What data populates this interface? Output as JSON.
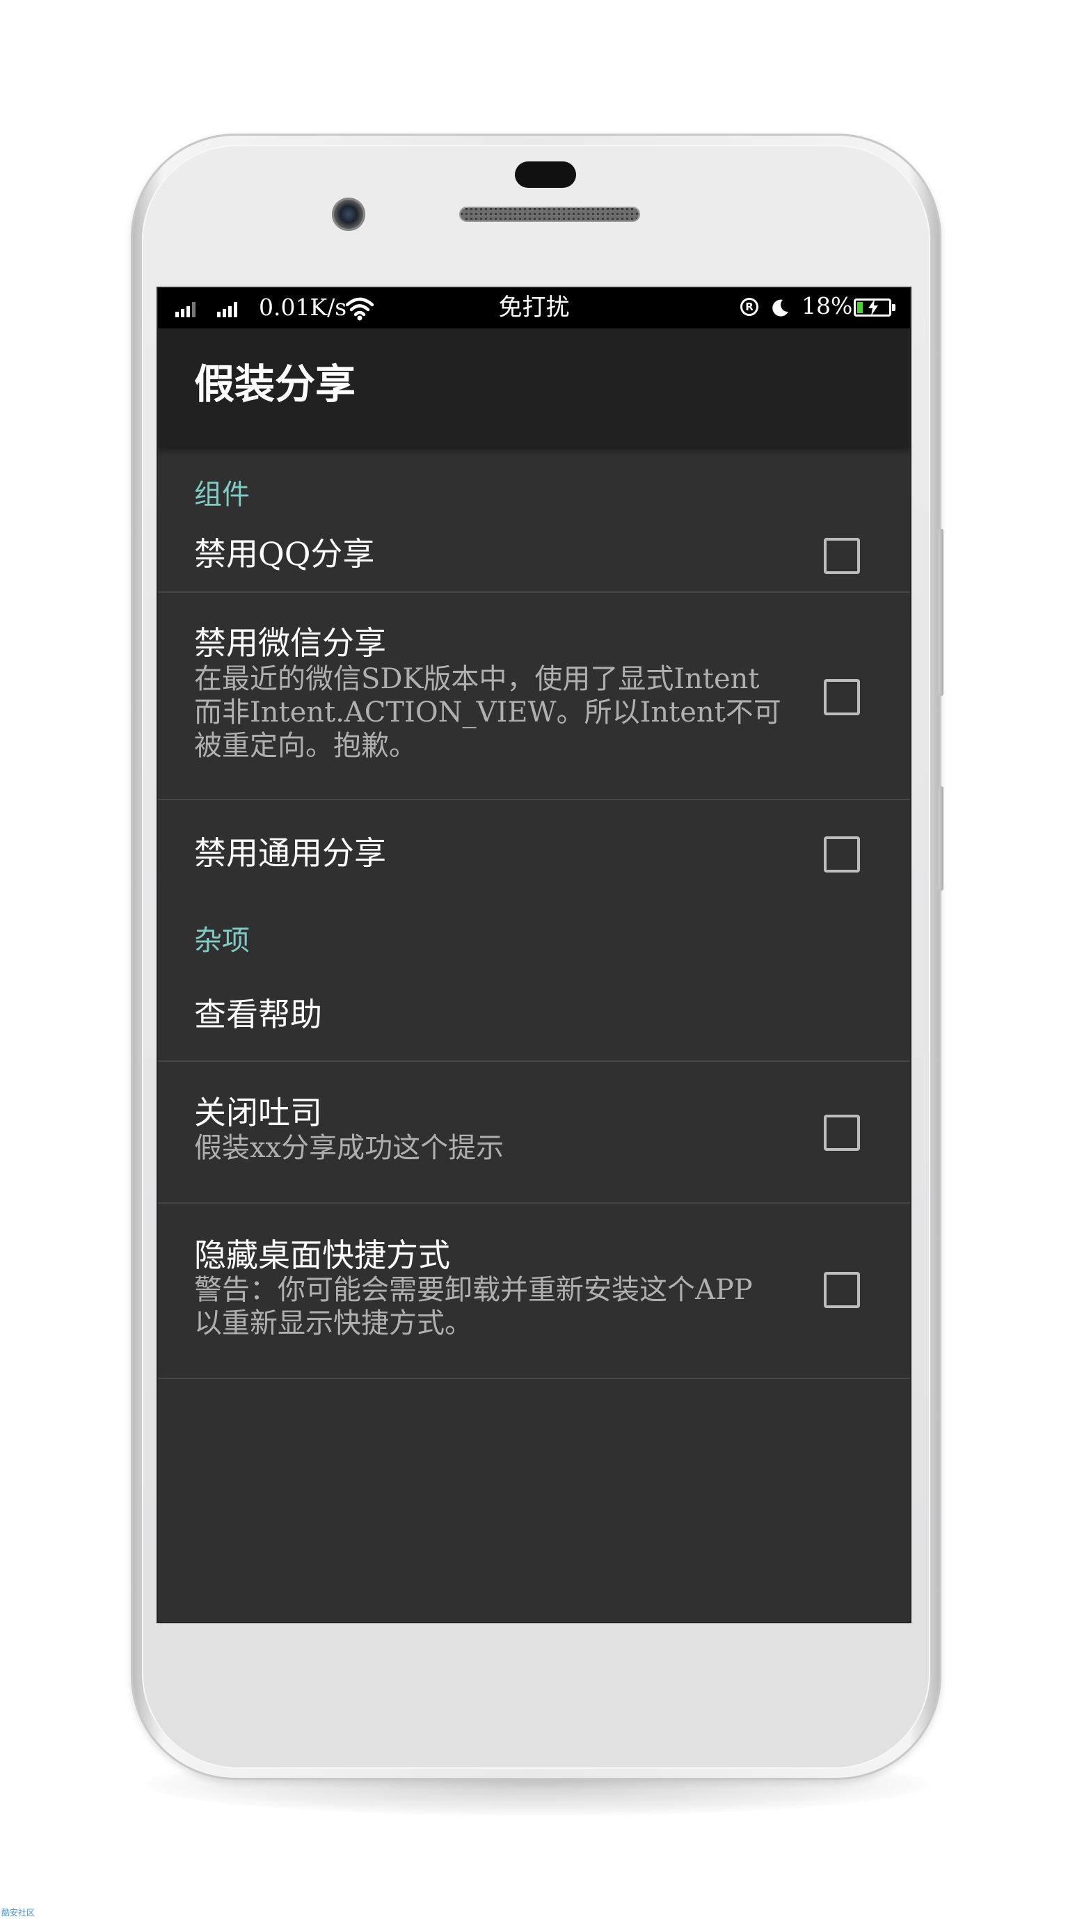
{
  "statusbar": {
    "net_speed": "0.01K/s",
    "mode": "免打扰",
    "r_badge": "R",
    "battery_pct": "18%",
    "battery_level": 0.18,
    "icons": [
      "signal-icon",
      "signal-icon",
      "wifi-icon",
      "registered-icon",
      "moon-icon",
      "battery-charging-icon"
    ]
  },
  "toolbar": {
    "title": "假装分享"
  },
  "sections": {
    "components": {
      "header": "组件",
      "items": [
        {
          "title": "禁用QQ分享",
          "summary": "",
          "checked": false
        },
        {
          "title": "禁用微信分享",
          "summary_lines": [
            "在最近的微信SDK版本中，使用了显式Intent",
            "而非Intent.ACTION_VIEW。所以Intent不可",
            "被重定向。抱歉。"
          ],
          "checked": false
        },
        {
          "title": "禁用通用分享",
          "summary": "",
          "checked": false
        }
      ]
    },
    "misc": {
      "header": "杂项",
      "items": [
        {
          "title": "查看帮助"
        },
        {
          "title": "关闭吐司",
          "summary_lines": [
            "假装xx分享成功这个提示"
          ],
          "checked": false
        },
        {
          "title": "隐藏桌面快捷方式",
          "summary_lines": [
            "警告：你可能会需要卸载并重新安装这个APP",
            "以重新显示快捷方式。"
          ],
          "checked": false
        }
      ]
    }
  },
  "footer": {
    "watermark": "酷安社区"
  },
  "colors": {
    "accent": "#80cbc4",
    "background": "#303030",
    "toolbar": "#212121",
    "statusbar": "#000000"
  }
}
